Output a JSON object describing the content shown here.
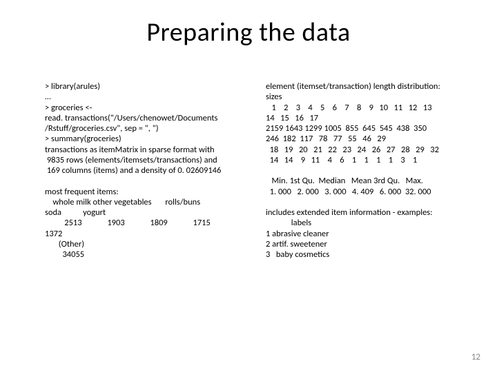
{
  "title": "Preparing the data",
  "left_col": "> library(arules)\n…\n> groceries <-\nread. transactions(\"/Users/chenowet/Documents\n/Rstuff/groceries.csv\", sep = \", \")\n> summary(groceries)\ntransactions as itemMatrix in sparse format with\n 9835 rows (elements/itemsets/transactions) and\n 169 columns (items) and a density of 0. 02609146\n\nmost frequent items:\n    whole milk other vegetables       rolls/buns\nsoda           yogurt\n          2513             1903             1809             1715\n1372\n       (Other)\n         34055",
  "right_col": "element (itemset/transaction) length distribution:\nsizes\n   1    2    3    4    5    6    7    8    9   10   11   12   13\n14   15   16   17\n2159 1643 1299 1005  855  645  545  438  350\n246  182  117   78   77   55   46   29\n  18   19   20   21   22   23   24   26   27   28   29   32\n  14   14    9   11    4    6    1    1    1    1    3    1\n\n   Min. 1st Qu.  Median   Mean 3rd Qu.   Max.\n  1. 000   2. 000   3. 000   4. 409   6. 000  32. 000\n\nincludes extended item information - examples:\n             labels\n1 abrasive cleaner\n2 artif. sweetener\n3   baby cosmetics",
  "page_number": "12",
  "chart_data": {
    "type": "table",
    "title": "R arules summary(groceries) output",
    "transactions_summary": {
      "rows": 9835,
      "columns": 169,
      "density": 0.02609146
    },
    "most_frequent_items": [
      {
        "item": "whole milk",
        "count": 2513
      },
      {
        "item": "other vegetables",
        "count": 1903
      },
      {
        "item": "rolls/buns",
        "count": 1809
      },
      {
        "item": "soda",
        "count": 1715
      },
      {
        "item": "yogurt",
        "count": 1372
      },
      {
        "item": "(Other)",
        "count": 34055
      }
    ],
    "length_distribution": {
      "sizes": [
        1,
        2,
        3,
        4,
        5,
        6,
        7,
        8,
        9,
        10,
        11,
        12,
        13,
        14,
        15,
        16,
        17,
        18,
        19,
        20,
        21,
        22,
        23,
        24,
        26,
        27,
        28,
        29,
        32
      ],
      "counts": [
        2159,
        1643,
        1299,
        1005,
        855,
        645,
        545,
        438,
        350,
        246,
        182,
        117,
        78,
        77,
        55,
        46,
        29,
        14,
        14,
        9,
        11,
        4,
        6,
        1,
        1,
        1,
        1,
        3,
        1
      ]
    },
    "length_stats": {
      "Min": 1.0,
      "1st Qu.": 2.0,
      "Median": 3.0,
      "Mean": 4.409,
      "3rd Qu.": 6.0,
      "Max": 32.0
    },
    "item_info_examples": [
      "abrasive cleaner",
      "artif. sweetener",
      "baby cosmetics"
    ]
  }
}
